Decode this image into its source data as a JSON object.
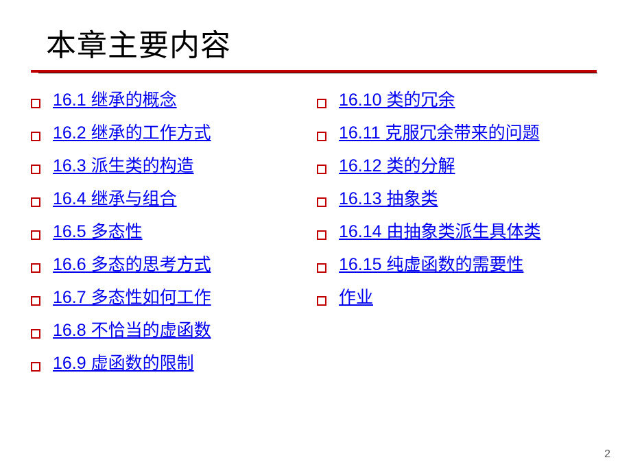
{
  "title": "本章主要内容",
  "leftItems": [
    "16.1 继承的概念",
    "16.2 继承的工作方式",
    "16.3 派生类的构造",
    "16.4 继承与组合",
    "16.5 多态性",
    "16.6 多态的思考方式",
    "16.7 多态性如何工作",
    "16.8 不恰当的虚函数",
    "16.9 虚函数的限制"
  ],
  "rightItems": [
    "16.10  类的冗余",
    "16.11  克服冗余带来的问题",
    "16.12  类的分解",
    "16.13  抽象类",
    "16.14  由抽象类派生具体类",
    "16.15  纯虚函数的需要性",
    "作业"
  ],
  "pageNumber": "2"
}
